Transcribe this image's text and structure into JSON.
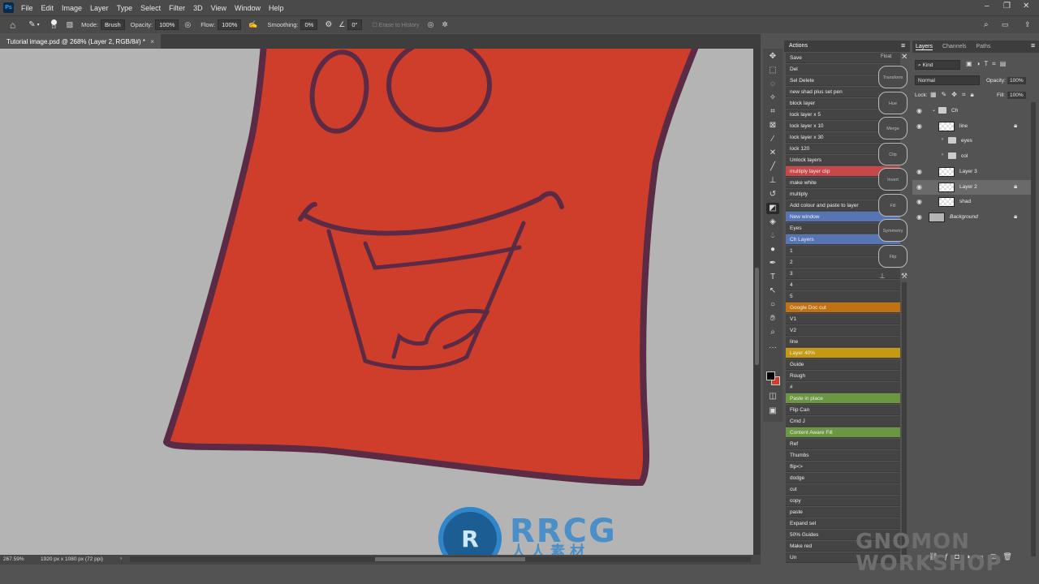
{
  "app": {
    "logo": "Ps"
  },
  "menu": [
    "File",
    "Edit",
    "Image",
    "Layer",
    "Type",
    "Select",
    "Filter",
    "3D",
    "View",
    "Window",
    "Help"
  ],
  "options": {
    "brush_size": "13",
    "mode_label": "Mode:",
    "mode_value": "Brush",
    "opacity_label": "Opacity:",
    "opacity_value": "100%",
    "flow_label": "Flow:",
    "flow_value": "100%",
    "smoothing_label": "Smoothing:",
    "smoothing_value": "0%",
    "angle_value": "0°",
    "erase_history": "Erase to History"
  },
  "document": {
    "tab_title": "Tutorial image.psd @ 268% (Layer 2, RGB/8#) *",
    "tab_close": "×",
    "status_zoom": "267.59%",
    "status_size": "1920 px x 1080 px (72 ppi)",
    "status_arrow": "›",
    "canvas_bg": "#b4b4b4",
    "shape_fill": "#cf3e2a",
    "outline": "#5b2a44"
  },
  "actions_panel": {
    "title": "Actions",
    "float_label": "Float",
    "items": [
      {
        "label": "Save",
        "color": ""
      },
      {
        "label": "Del",
        "color": ""
      },
      {
        "label": "Sel Delete",
        "color": ""
      },
      {
        "label": "new shad plus set pen",
        "color": ""
      },
      {
        "label": "block layer",
        "color": ""
      },
      {
        "label": "lock layer x 5",
        "color": ""
      },
      {
        "label": "lock layer x 10",
        "color": ""
      },
      {
        "label": "lock layer x 30",
        "color": ""
      },
      {
        "label": "lock 120",
        "color": ""
      },
      {
        "label": "Unlock layers",
        "color": ""
      },
      {
        "label": "multiply layer clip",
        "color": "#c8474a"
      },
      {
        "label": "make white",
        "color": ""
      },
      {
        "label": "multiply",
        "color": ""
      },
      {
        "label": "Add colour and paste to layer",
        "color": ""
      },
      {
        "label": "New window",
        "color": "#5775b5"
      },
      {
        "label": "Eyes",
        "color": ""
      },
      {
        "label": "Ch Layers",
        "color": "#5775b5"
      },
      {
        "label": "1",
        "color": ""
      },
      {
        "label": "2",
        "color": ""
      },
      {
        "label": "3",
        "color": ""
      },
      {
        "label": "4",
        "color": ""
      },
      {
        "label": "5",
        "color": ""
      },
      {
        "label": "Google Doc cut",
        "color": "#c07112"
      },
      {
        "label": "V1",
        "color": ""
      },
      {
        "label": "V2",
        "color": ""
      },
      {
        "label": "line",
        "color": ""
      },
      {
        "label": "Layer 40%",
        "color": "#c59a12"
      },
      {
        "label": "Guide",
        "color": ""
      },
      {
        "label": "Rough",
        "color": ""
      },
      {
        "label": "#",
        "color": ""
      },
      {
        "label": "Paste in place",
        "color": "#6b9642"
      },
      {
        "label": "Flip Can",
        "color": ""
      },
      {
        "label": "Cmd J",
        "color": ""
      },
      {
        "label": "Content Aware Fill",
        "color": "#6b9642"
      },
      {
        "label": "Ref",
        "color": ""
      },
      {
        "label": "Thumbs",
        "color": ""
      },
      {
        "label": "flip<>",
        "color": ""
      },
      {
        "label": "dodge",
        "color": ""
      },
      {
        "label": "cut",
        "color": ""
      },
      {
        "label": "copy",
        "color": ""
      },
      {
        "label": "paste",
        "color": ""
      },
      {
        "label": "Expand sel",
        "color": ""
      },
      {
        "label": "50% Guides",
        "color": ""
      },
      {
        "label": "Make red",
        "color": ""
      },
      {
        "label": "Un",
        "color": ""
      }
    ],
    "float_buttons": [
      "Transform",
      "Hue",
      "Merge",
      "Clip",
      "Invert",
      "Fill",
      "Symmetry",
      "Flip"
    ]
  },
  "layers_panel": {
    "tabs": [
      "Layers",
      "Channels",
      "Paths"
    ],
    "kind": "Kind",
    "blend_mode": "Normal",
    "opacity_label": "Opacity:",
    "opacity_value": "100%",
    "lock_label": "Lock:",
    "fill_label": "Fill:",
    "fill_value": "100%",
    "layers": [
      {
        "name": "Ch",
        "type": "group",
        "visible": true,
        "locked": false
      },
      {
        "name": "line",
        "type": "layer",
        "visible": true,
        "locked": true
      },
      {
        "name": "eyes",
        "type": "group",
        "visible": false,
        "locked": false
      },
      {
        "name": "col",
        "type": "group",
        "visible": false,
        "locked": false
      },
      {
        "name": "Layer 3",
        "type": "layer",
        "visible": true,
        "locked": false
      },
      {
        "name": "Layer 2",
        "type": "layer",
        "visible": true,
        "locked": true,
        "selected": true
      },
      {
        "name": "shad",
        "type": "layer",
        "visible": true,
        "locked": false
      },
      {
        "name": "Background",
        "type": "background",
        "visible": true,
        "locked": true
      }
    ]
  },
  "watermarks": {
    "rrcg_title": "RRCG",
    "rrcg_sub": "人人素材",
    "gnomon_1": "GNOMON",
    "gnomon_2": "WORKSHOP"
  }
}
